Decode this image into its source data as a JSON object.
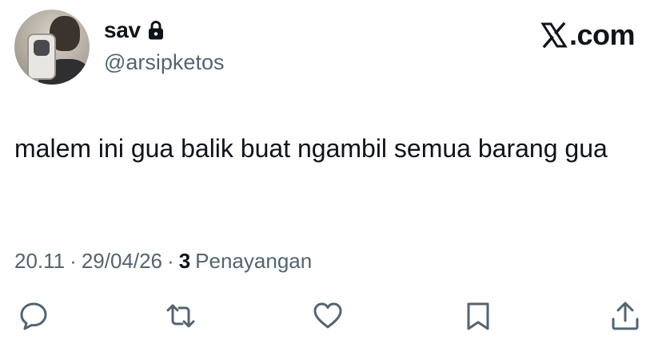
{
  "user": {
    "display_name": "sav",
    "handle": "@arsipketos",
    "protected_icon": "lock-icon"
  },
  "brand": {
    "label": ".com",
    "logo_icon": "x-logo-icon"
  },
  "tweet": {
    "text": "malem ini gua balik buat ngambil semua barang gua"
  },
  "meta": {
    "time": "20.11",
    "separator": "·",
    "date": "29/04/26",
    "views_count": "3",
    "views_label": "Penayangan"
  },
  "actions": [
    "reply-icon",
    "retweet-icon",
    "like-icon",
    "bookmark-icon",
    "share-icon"
  ],
  "colors": {
    "text": "#0f1419",
    "secondary": "#536471",
    "background": "#ffffff"
  }
}
